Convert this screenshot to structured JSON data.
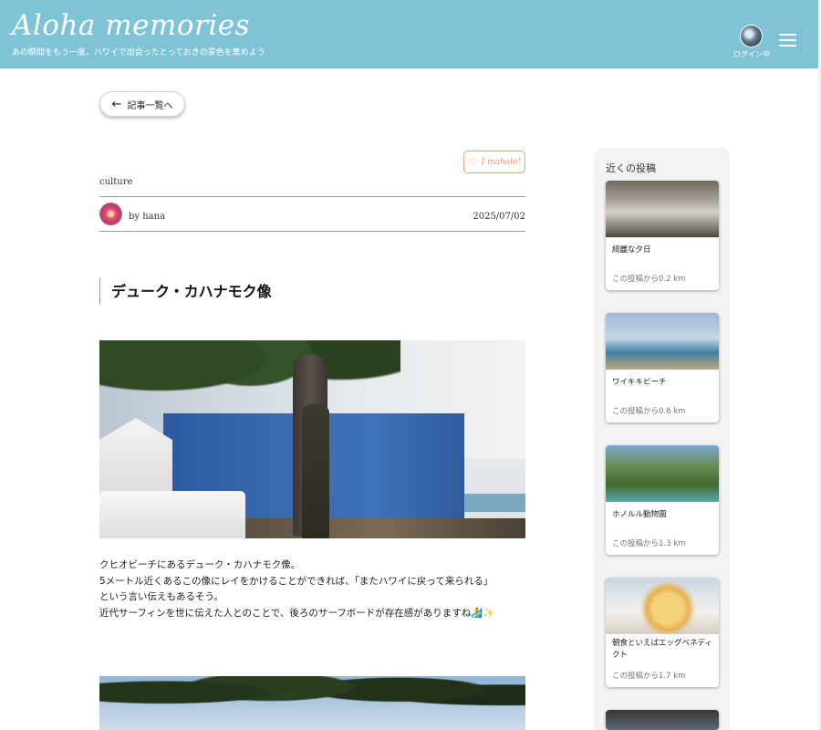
{
  "header": {
    "title": "Aloha memories",
    "subtitle": "あの瞬間をもう一度。ハワイで出会ったとっておきの景色を集めよう",
    "login_label": "ログイン中"
  },
  "nav": {
    "back_label": "記事一覧へ"
  },
  "post": {
    "mahalo_label": "I mahalo!",
    "category": "culture",
    "author": "by hana",
    "date": "2025/07/02",
    "title": "デューク・カハナモク像",
    "body_lines": [
      "クヒオビーチにあるデューク・カハナモク像。",
      "5メートル近くあるこの像にレイをかけることができれば、「またハワイに戻って来られる」",
      "という言い伝えもあるそう。",
      "近代サーフィンを世に伝えた人とのことで、後ろのサーフボードが存在感がありますね🏄✨"
    ]
  },
  "sidebar": {
    "title": "近くの投稿",
    "items": [
      {
        "name": "綺麗な夕日",
        "distance": "この投稿から0.2 km"
      },
      {
        "name": "ワイキキビーチ",
        "distance": "この投稿から0.6 km"
      },
      {
        "name": "ホノルル動物園",
        "distance": "この投稿から1.3 km"
      },
      {
        "name": "朝食といえばエッグベネディクト",
        "distance": "この投稿から1.7 km"
      }
    ]
  },
  "colors": {
    "header_bg": "#7fc3d6",
    "mahalo_accent": "#e89070",
    "sidebar_bg": "#f3f3f3"
  },
  "icons": {
    "back": "arrow-left-icon",
    "mahalo": "heart-icon",
    "menu": "hamburger-menu-icon"
  }
}
